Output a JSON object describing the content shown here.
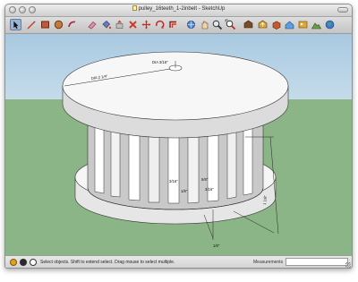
{
  "window": {
    "title": "pulley_16teeth_1-2inbelt - SketchUp"
  },
  "toolbar": {
    "tools": [
      {
        "name": "select-arrow-icon",
        "selected": true
      },
      {
        "name": "pencil-line-icon"
      },
      {
        "name": "rectangle-icon"
      },
      {
        "name": "circle-icon"
      },
      {
        "name": "arc-icon"
      },
      {
        "name": "eraser-icon"
      },
      {
        "name": "paint-bucket-icon"
      },
      {
        "name": "push-pull-icon"
      },
      {
        "name": "follow-me-icon"
      },
      {
        "name": "move-icon"
      },
      {
        "name": "rotate-icon"
      },
      {
        "name": "offset-icon"
      },
      {
        "name": "orbit-icon"
      },
      {
        "name": "pan-icon"
      },
      {
        "name": "zoom-icon"
      },
      {
        "name": "zoom-extents-icon"
      },
      {
        "name": "get-models-icon"
      },
      {
        "name": "share-model-icon"
      },
      {
        "name": "components-icon"
      },
      {
        "name": "place-model-icon"
      },
      {
        "name": "photo-texture-icon"
      },
      {
        "name": "toggle-terrain-icon"
      },
      {
        "name": "google-earth-icon"
      }
    ]
  },
  "model": {
    "dimensions": {
      "top_hole": "DIA 3/16\"",
      "top_diameter": "DIA 2 1/4\"",
      "tooth_gap_a": "3/16\"",
      "tooth_gap_b": "5/8\"",
      "tooth_width": "1/8\"",
      "tooth_depth": "3/16\"",
      "height": "1 1/8\"",
      "flange": "1/8\""
    }
  },
  "status": {
    "hint": "Select objects. Shift to extend select. Drag mouse to select multiple.",
    "measurements_label": "Measurements",
    "measurements_value": ""
  },
  "colors": {
    "sky": "#a8c8e0",
    "ground": "#8cb587",
    "model_face": "#f7f7f7",
    "model_shadow": "#c8c8c8"
  }
}
